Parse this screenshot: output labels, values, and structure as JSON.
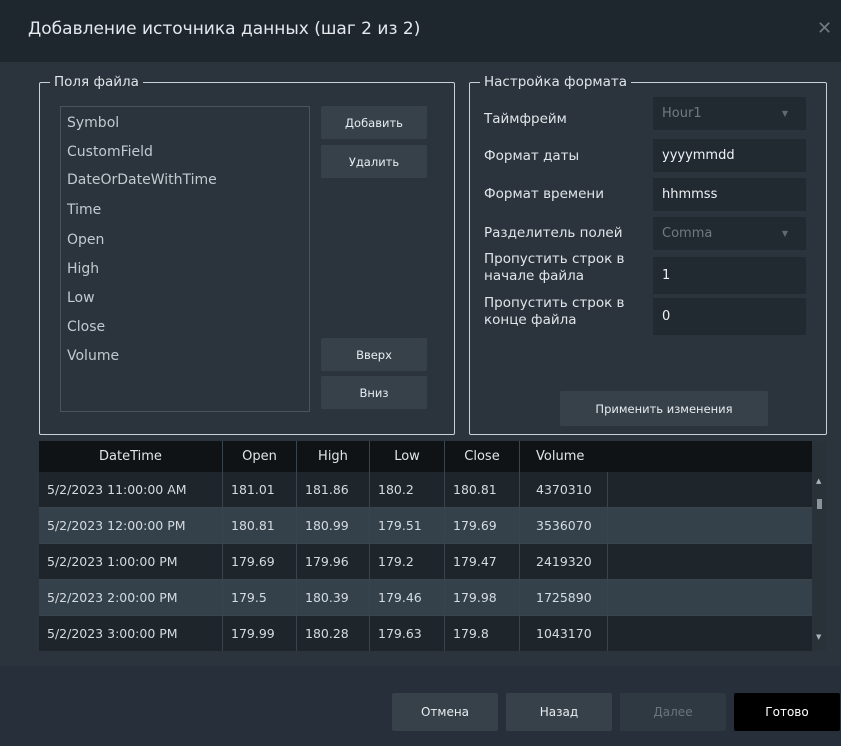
{
  "dialog": {
    "title": "Добавление источника данных (шаг 2 из 2)",
    "close_glyph": "✕"
  },
  "file_fields": {
    "legend": "Поля файла",
    "items": [
      "Symbol",
      "CustomField",
      "DateOrDateWithTime",
      "Time",
      "Open",
      "High",
      "Low",
      "Close",
      "Volume"
    ],
    "add_label": "Добавить",
    "remove_label": "Удалить",
    "up_label": "Вверх",
    "down_label": "Вниз"
  },
  "format": {
    "legend": "Настройка формата",
    "timeframe_label": "Таймфрейм",
    "timeframe_value": "Hour1",
    "date_format_label": "Формат даты",
    "date_format_value": "yyyymmdd",
    "time_format_label": "Формат времени",
    "time_format_value": "hhmmss",
    "separator_label": "Разделитель полей",
    "separator_value": "Comma",
    "skip_start_label_1": "Пропустить строк в",
    "skip_start_label_2": "начале файла",
    "skip_start_value": "1",
    "skip_end_label_1": "Пропустить строк в",
    "skip_end_label_2": "конце файла",
    "skip_end_value": "0",
    "apply_label": "Применить изменения"
  },
  "grid": {
    "columns": [
      "DateTime",
      "Open",
      "High",
      "Low",
      "Close",
      "Volume"
    ],
    "rows": [
      [
        "5/2/2023 11:00:00 AM",
        "181.01",
        "181.86",
        "180.2",
        "180.81",
        "4370310"
      ],
      [
        "5/2/2023 12:00:00 PM",
        "180.81",
        "180.99",
        "179.51",
        "179.69",
        "3536070"
      ],
      [
        "5/2/2023 1:00:00 PM",
        "179.69",
        "179.96",
        "179.2",
        "179.47",
        "2419320"
      ],
      [
        "5/2/2023 2:00:00 PM",
        "179.5",
        "180.39",
        "179.46",
        "179.98",
        "1725890"
      ],
      [
        "5/2/2023 3:00:00 PM",
        "179.99",
        "180.28",
        "179.63",
        "179.8",
        "1043170"
      ]
    ]
  },
  "footer": {
    "cancel_label": "Отмена",
    "back_label": "Назад",
    "next_label": "Далее",
    "finish_label": "Готово"
  },
  "colors": {
    "background": "#2b343c",
    "titlebar": "#1f272e",
    "row_alt": "#34414b",
    "row": "#1e252b",
    "finish_button": "#000000"
  }
}
